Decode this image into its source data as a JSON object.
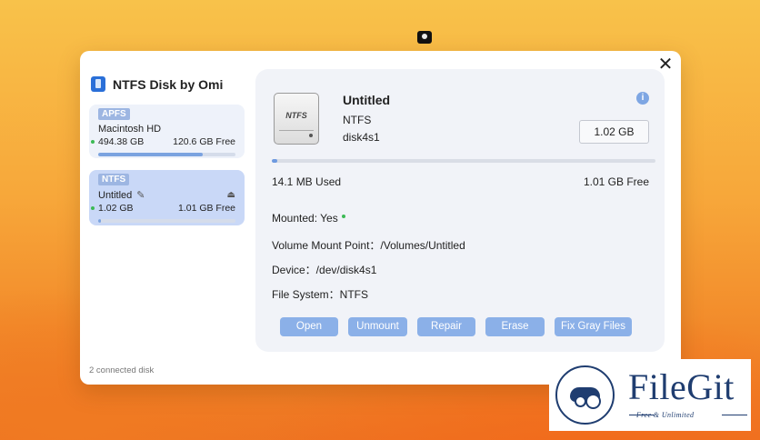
{
  "app": {
    "title": "NTFS Disk by Omi",
    "connected_text": "2 connected disk"
  },
  "disks": [
    {
      "fs": "APFS",
      "name": "Macintosh HD",
      "size": "494.38 GB",
      "free": "120.6 GB Free",
      "used_fraction": 0.76
    },
    {
      "fs": "NTFS",
      "name": "Untitled",
      "size": "1.02 GB",
      "free": "1.01 GB Free",
      "used_fraction": 0.02
    }
  ],
  "detail": {
    "hdd_label": "NTFS",
    "name": "Untitled",
    "filesystem": "NTFS",
    "device_id": "disk4s1",
    "capacity": "1.02 GB",
    "used": "14.1 MB Used",
    "free": "1.01 GB Free",
    "used_fraction": 0.014,
    "mounted": "Mounted: Yes",
    "mount_point": "Volume Mount Point：/Volumes/Untitled",
    "device": "Device：/dev/disk4s1",
    "file_system": "File System：NTFS"
  },
  "buttons": {
    "open": "Open",
    "unmount": "Unmount",
    "repair": "Repair",
    "erase": "Erase",
    "fix_gray": "Fix Gray Files"
  },
  "icons": {
    "close": "✕",
    "info": "i",
    "pencil": "✎",
    "eject": "⏏"
  },
  "watermark": {
    "title": "FileGit",
    "tagline": "Free & Unlimited"
  },
  "colors": {
    "accent": "#8bb0e8",
    "selected_card": "#c9d8f7",
    "status_green": "#3cba55"
  }
}
